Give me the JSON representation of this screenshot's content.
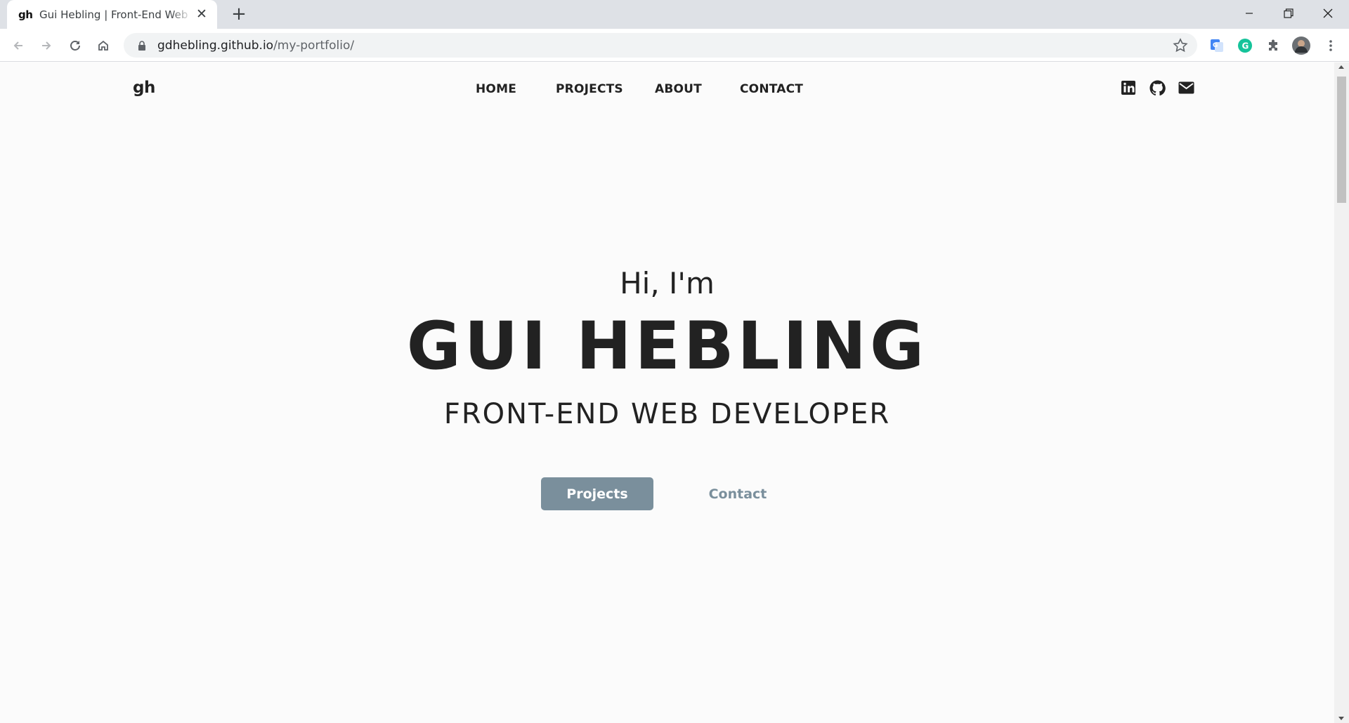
{
  "browser": {
    "tab": {
      "favicon_text": "gh",
      "title": "Gui Hebling | Front-End Web Developer",
      "close_icon": "close-icon"
    },
    "new_tab_label": "+",
    "address": {
      "host": "gdhebling.github.io",
      "path": "/my-portfolio/"
    }
  },
  "site": {
    "logo": "gh",
    "nav": {
      "home": "HOME",
      "projects": "PROJECTS",
      "about": "ABOUT",
      "contact": "CONTACT"
    },
    "social_icons": [
      "linkedin-icon",
      "github-icon",
      "email-icon"
    ]
  },
  "hero": {
    "greeting": "Hi, I'm",
    "name": "GUI HEBLING",
    "role": "FRONT-END WEB DEVELOPER",
    "primary_button": "Projects",
    "secondary_button": "Contact"
  },
  "colors": {
    "accent": "#7a8f9c",
    "text": "#222222",
    "background": "#fbfbfb"
  }
}
